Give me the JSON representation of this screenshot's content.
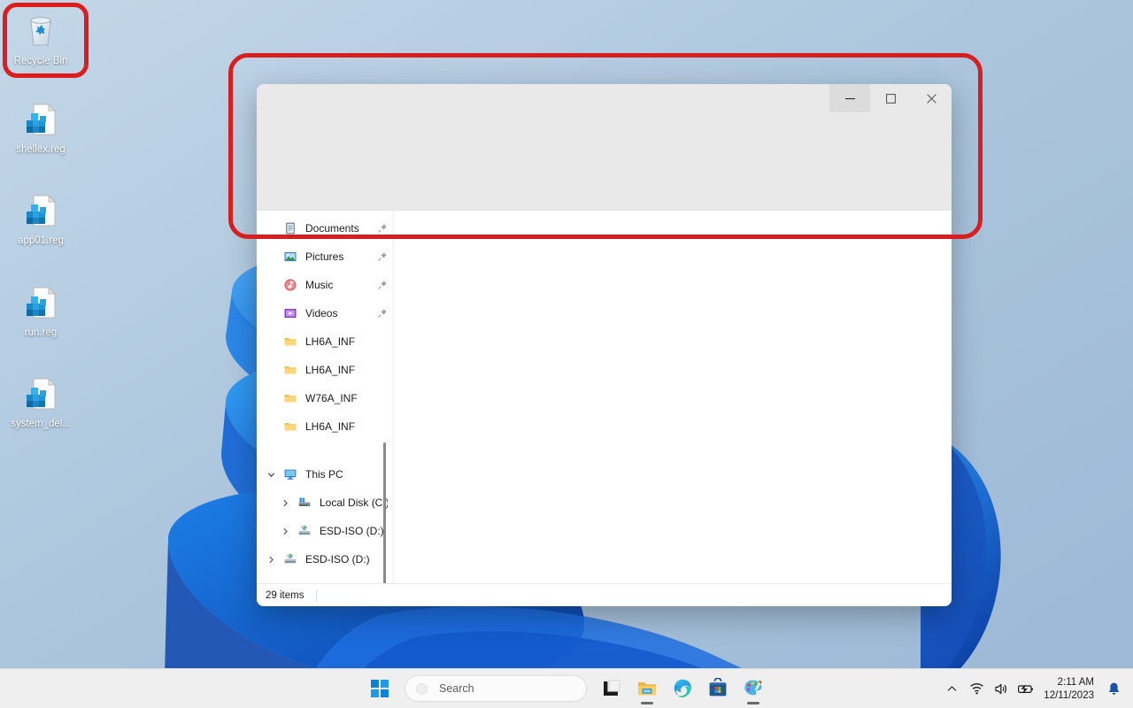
{
  "desktop": {
    "icons": [
      {
        "name": "recycle-bin",
        "label": "Recycle Bin",
        "icon": "recycle-bin-icon",
        "highlighted": true
      },
      {
        "name": "shellex-reg",
        "label": "shellex.reg",
        "icon": "registry-file-icon",
        "highlighted": false
      },
      {
        "name": "app01-reg",
        "label": "app01.reg",
        "icon": "registry-file-icon",
        "highlighted": false
      },
      {
        "name": "run-reg",
        "label": "run.reg",
        "icon": "registry-file-icon",
        "highlighted": false
      },
      {
        "name": "system-del-reg",
        "label": "system_del...",
        "icon": "registry-file-icon",
        "highlighted": false
      }
    ]
  },
  "annotations": {
    "highlight_color": "#d81f20",
    "recycle_bin_box": {
      "label": "recycle-bin-highlight"
    },
    "window_top_box": {
      "label": "explorer-toolbar-highlight"
    }
  },
  "explorer": {
    "window_controls": {
      "minimize": "minimize-icon",
      "maximize": "maximize-icon",
      "close": "close-icon",
      "hovered": "minimize"
    },
    "sidebar": {
      "quick_access": [
        {
          "label": "Documents",
          "icon": "documents-icon",
          "pinned": true
        },
        {
          "label": "Pictures",
          "icon": "pictures-icon",
          "pinned": true
        },
        {
          "label": "Music",
          "icon": "music-icon",
          "pinned": true
        },
        {
          "label": "Videos",
          "icon": "videos-icon",
          "pinned": true
        },
        {
          "label": "LH6A_INF",
          "icon": "folder-icon",
          "pinned": false
        },
        {
          "label": "LH6A_INF",
          "icon": "folder-icon",
          "pinned": false
        },
        {
          "label": "W76A_INF",
          "icon": "folder-icon",
          "pinned": false
        },
        {
          "label": "LH6A_INF",
          "icon": "folder-icon",
          "pinned": false
        }
      ],
      "this_pc": {
        "label": "This PC",
        "icon": "this-pc-icon",
        "expanded": true,
        "children": [
          {
            "label": "Local Disk (C:)",
            "icon": "local-disk-icon",
            "expanded": false
          },
          {
            "label": "ESD-ISO (D:)",
            "icon": "dvd-drive-icon",
            "expanded": false
          }
        ]
      },
      "extra": [
        {
          "label": "ESD-ISO (D:)",
          "icon": "dvd-drive-icon",
          "expanded": false
        }
      ]
    },
    "status": {
      "item_count": "29 items"
    }
  },
  "taskbar": {
    "start": "start-icon",
    "search": {
      "placeholder": "Search",
      "icon": "search-icon"
    },
    "buttons": [
      {
        "name": "task-view",
        "icon": "task-view-icon",
        "running": false
      },
      {
        "name": "file-explorer",
        "icon": "file-explorer-icon",
        "running": true
      },
      {
        "name": "microsoft-edge",
        "icon": "edge-icon",
        "running": false
      },
      {
        "name": "microsoft-store",
        "icon": "store-icon",
        "running": false
      },
      {
        "name": "paint",
        "icon": "paint-icon",
        "running": true
      }
    ],
    "tray": {
      "overflow": "chevron-up-icon",
      "network": "wifi-icon",
      "volume": "speaker-icon",
      "battery": "battery-icon",
      "time": "2:11 AM",
      "date": "12/11/2023",
      "notifications": "bell-icon"
    }
  },
  "colors": {
    "annotation_red": "#d81f20",
    "taskbar_bg": "#efefef",
    "window_chrome": "#e9e9e9",
    "accent_blue": "#0078d4"
  }
}
